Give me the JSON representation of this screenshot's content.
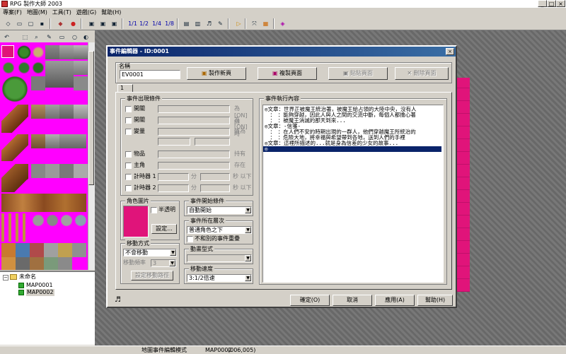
{
  "window": {
    "title": "RPG 製作大師 2003",
    "min": "_",
    "max": "□",
    "close": "×"
  },
  "menu": [
    "專案(F)",
    "地圖(M)",
    "工具(T)",
    "遊戲(G)",
    "幫助(H)"
  ],
  "toolbar": {
    "layer_labels": [
      "1/1",
      "1/2",
      "1/4",
      "1/8"
    ]
  },
  "tree": {
    "root": "未命名",
    "maps": [
      "MAP0001",
      "MAP0002"
    ]
  },
  "status": {
    "mode": "地圖事件編輯模式",
    "map": "MAP0002",
    "coord": "(006,005)"
  },
  "dialog": {
    "title": "事件編輯器 - ID:0001",
    "name_label": "名稱",
    "name_value": "EV0001",
    "new_page": "製作新頁",
    "copy_page": "複製頁面",
    "paste_page": "貼貼頁面",
    "delete_page": "刪除頁面",
    "page_tab": "1",
    "conditions": {
      "title": "事件出現條件",
      "switch1": "開關",
      "switch2": "開關",
      "variable": "變量",
      "item": "物品",
      "hero": "主角",
      "timer1": "計時器 1",
      "timer2": "計時器 2",
      "is_on": "為[ON]時",
      "above": "值為",
      "possess": "持有",
      "present": "存在",
      "minutes": "分",
      "seconds": "秒 以下"
    },
    "graphic": {
      "title": "角色圖片",
      "transparent": "半透明",
      "set": "設定..."
    },
    "trigger": {
      "title": "事件開始條件",
      "value": "自動開始"
    },
    "layer": {
      "title": "事件所在層次",
      "value": "普通角色之下",
      "overlap": "不和別的事件重疊"
    },
    "movement": {
      "title": "移動方式",
      "value": "不會移動",
      "freq_label": "移動頻率",
      "freq_value": "3",
      "route": "設定移動路徑",
      "anim_title": "動畫型式",
      "speed_title": "移動速度",
      "speed_value": "3:1/2倍速"
    },
    "commands": {
      "title": "事件執行內容",
      "lines": [
        "◎文章：世界正被魔王統治著，被魔王給占領的大陸中央，沒有人",
        "　：　：能夠穿越，因此人與人之間的交流中斷，每個人都擔心著",
        "　：　：被魔王消滅的那天到來...",
        "◎文章：-信箋-",
        "　：　：在人們不安的時期出現的一群人，他們穿越魔王所統治的",
        "　：　：危險大地，將幸福與希望帶到各地，送到人們的手裡",
        "◎文章：這裡所描述的...就是身為信差的少女的故事...",
        "◎"
      ]
    },
    "ok": "確定(O)",
    "cancel": "取消",
    "apply": "應用(A)",
    "help": "幫助(H)"
  }
}
